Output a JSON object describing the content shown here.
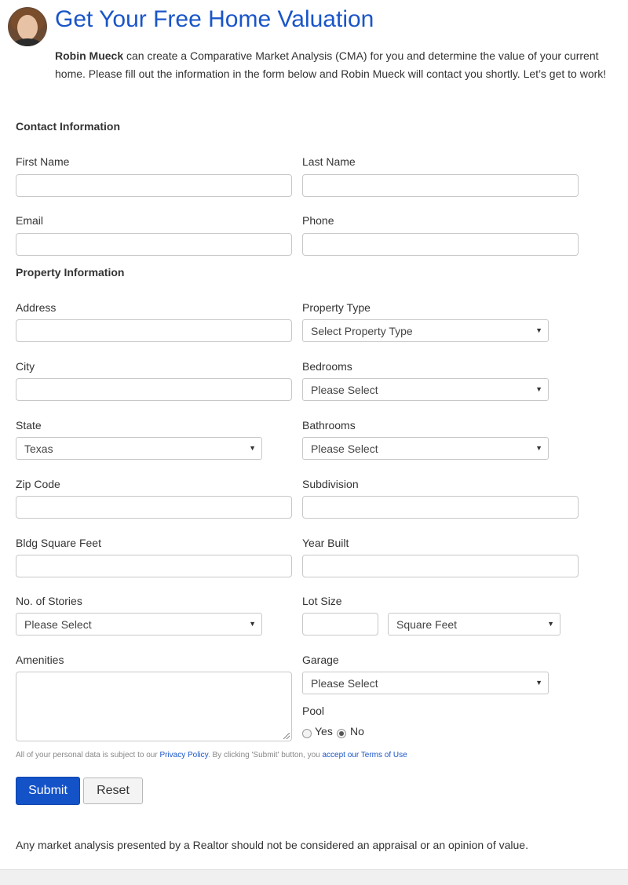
{
  "header": {
    "title": "Get Your Free Home Valuation",
    "agent_name": "Robin Mueck",
    "intro_part1": " can create a Comparative Market Analysis (CMA) for you and determine the value of your current home. Please fill out the information in the form below and ",
    "intro_agent2": "Robin Mueck",
    "intro_part2": " will contact you shortly. Let’s get to work!"
  },
  "contact": {
    "heading": "Contact Information",
    "first_name_label": "First Name",
    "last_name_label": "Last Name",
    "email_label": "Email",
    "phone_label": "Phone"
  },
  "property": {
    "heading": "Property Information",
    "address_label": "Address",
    "property_type_label": "Property Type",
    "property_type_value": "Select Property Type",
    "city_label": "City",
    "bedrooms_label": "Bedrooms",
    "bedrooms_value": "Please Select",
    "state_label": "State",
    "state_value": "Texas",
    "bathrooms_label": "Bathrooms",
    "bathrooms_value": "Please Select",
    "zip_label": "Zip Code",
    "subdivision_label": "Subdivision",
    "sqft_label": "Bldg Square Feet",
    "year_built_label": "Year Built",
    "stories_label": "No. of Stories",
    "stories_value": "Please Select",
    "lot_size_label": "Lot Size",
    "lot_unit_value": "Square Feet",
    "amenities_label": "Amenities",
    "garage_label": "Garage",
    "garage_value": "Please Select",
    "pool_label": "Pool",
    "pool_yes": "Yes",
    "pool_no": "No",
    "pool_selected": "No"
  },
  "legal": {
    "text1": "All of your personal data is subject to our ",
    "privacy_link": "Privacy Policy",
    "text2": ". By clicking 'Submit' button, you ",
    "terms_link": "accept our Terms of Use"
  },
  "buttons": {
    "submit": "Submit",
    "reset": "Reset"
  },
  "disclaimer": "Any market analysis presented by a Realtor should not be considered an appraisal or an opinion of value.",
  "icons": {
    "select_caret": "▼"
  },
  "colors": {
    "title": "#1a55c8",
    "submit_bg": "#1452c8",
    "link": "#1a55c8"
  }
}
